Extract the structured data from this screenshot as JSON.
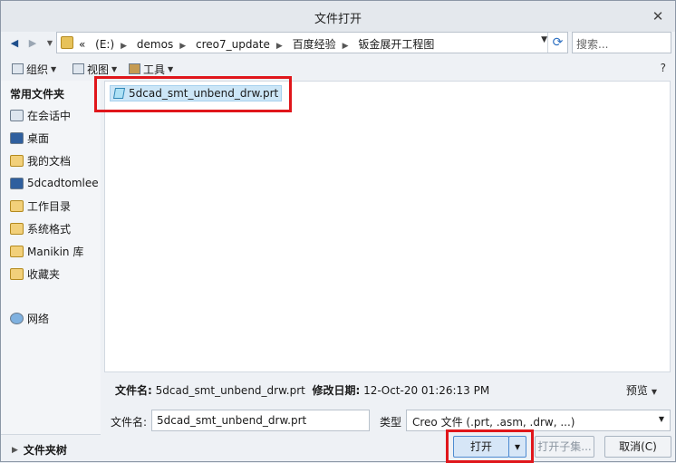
{
  "window": {
    "title": "文件打开",
    "close_glyph": "✕"
  },
  "address": {
    "crumbs": [
      "«",
      "(E:)",
      "demos",
      "creo7_update",
      "百度经验",
      "钣金展开工程图"
    ],
    "search_placeholder": "搜索..."
  },
  "toolbar": {
    "organize": "组织",
    "view": "视图",
    "tools": "工具",
    "help_glyph": "?"
  },
  "nav": {
    "header": "常用文件夹",
    "items": [
      {
        "label": "在会话中",
        "icon": "monitor-icon"
      },
      {
        "label": "桌面",
        "icon": "desktop-icon"
      },
      {
        "label": "我的文档",
        "icon": "documents-icon"
      },
      {
        "label": "5dcadtomlee",
        "icon": "computer-icon"
      },
      {
        "label": "工作目录",
        "icon": "working-folder-icon"
      },
      {
        "label": "系统格式",
        "icon": "folder-icon"
      },
      {
        "label": "Manikin 库",
        "icon": "folder-icon"
      },
      {
        "label": "收藏夹",
        "icon": "favorites-icon"
      },
      {
        "label": "网络",
        "icon": "network-icon"
      }
    ],
    "folder_tree": "文件夹树"
  },
  "files": [
    {
      "name": "5dcad_smt_unbend_drw.prt",
      "selected": true
    }
  ],
  "info": {
    "filename_label": "文件名:",
    "filename": "5dcad_smt_unbend_drw.prt",
    "modified_label": "修改日期:",
    "modified": "12-Oct-20 01:26:13 PM",
    "preview": "预览"
  },
  "bottom": {
    "filename_label": "文件名:",
    "filename_value": "5dcad_smt_unbend_drw.prt",
    "type_label": "类型",
    "type_value": "Creo 文件 (.prt, .asm, .drw, ...)",
    "open": "打开",
    "open_representation": "打开子集...",
    "cancel": "取消(C)"
  },
  "colors": {
    "highlight": "#e0161b",
    "selection": "#cce6f7"
  }
}
